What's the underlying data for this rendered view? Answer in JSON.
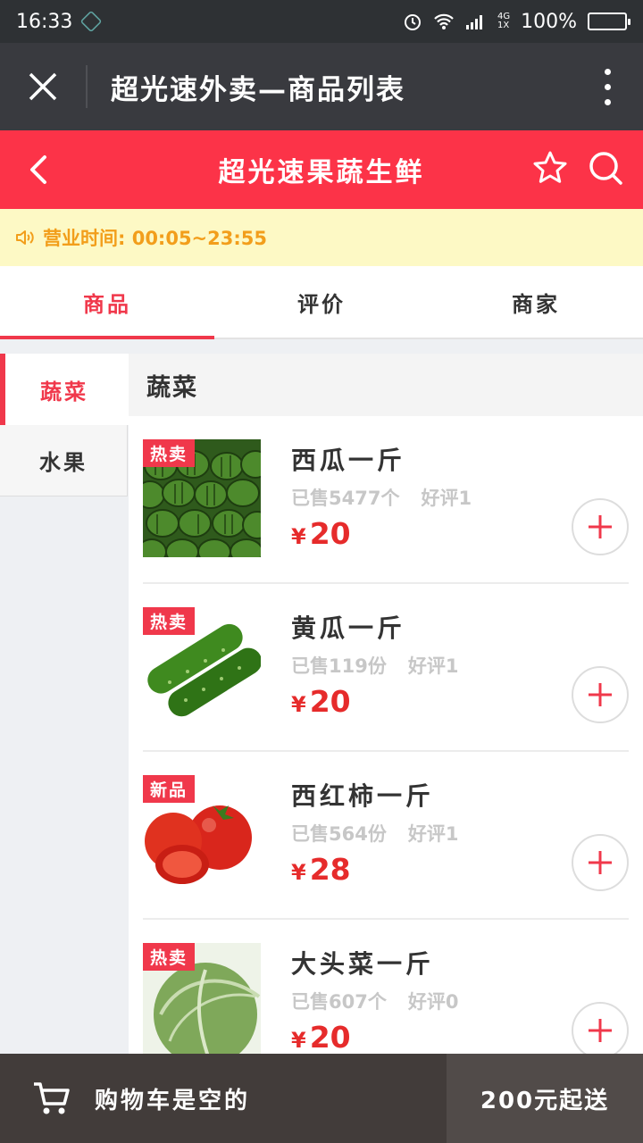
{
  "status_bar": {
    "time": "16:33",
    "network": "4G",
    "network2": "1X",
    "battery_text": "100%"
  },
  "title_bar": {
    "title": "超光速外卖—商品列表"
  },
  "shop_bar": {
    "shop_name": "超光速果蔬生鲜"
  },
  "notice": {
    "text": "营业时间: 00:05~23:55"
  },
  "tabs": [
    {
      "label": "商品",
      "active": true
    },
    {
      "label": "评价",
      "active": false
    },
    {
      "label": "商家",
      "active": false
    }
  ],
  "categories": [
    {
      "label": "蔬菜",
      "active": true
    },
    {
      "label": "水果",
      "active": false
    }
  ],
  "section_title": "蔬菜",
  "products": [
    {
      "badge": "热卖",
      "name": "西瓜一斤",
      "sold": "已售5477个",
      "rating": "好评1",
      "currency": "¥",
      "price": "20",
      "image": "watermelon"
    },
    {
      "badge": "热卖",
      "name": "黄瓜一斤",
      "sold": "已售119份",
      "rating": "好评1",
      "currency": "¥",
      "price": "20",
      "image": "cucumber"
    },
    {
      "badge": "新品",
      "name": "西红柿一斤",
      "sold": "已售564份",
      "rating": "好评1",
      "currency": "¥",
      "price": "28",
      "image": "tomato"
    },
    {
      "badge": "热卖",
      "name": "大头菜一斤",
      "sold": "已售607个",
      "rating": "好评0",
      "currency": "¥",
      "price": "20",
      "image": "cabbage"
    }
  ],
  "cart_bar": {
    "text": "购物车是空的",
    "min_order": "200元起送"
  },
  "colors": {
    "brand": "#fc3348",
    "accent_text": "#f0384b",
    "price": "#e62b2b",
    "notice_bg": "#fdf9c5",
    "notice_text": "#f29e1b"
  }
}
